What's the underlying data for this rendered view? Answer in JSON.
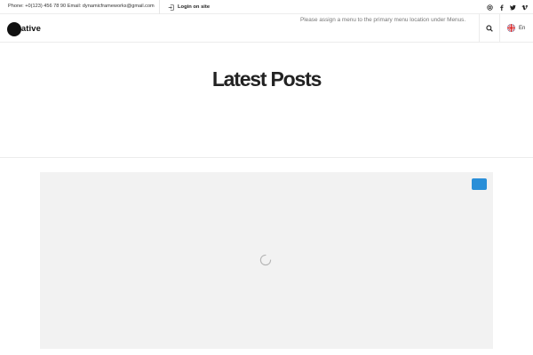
{
  "topbar": {
    "contact": "Phone: +0(123) 456 78 90 Email: dynamicframeworks@gmail.com",
    "login_label": "Login on site",
    "login_icon": "login-icon",
    "social_icons": [
      "instagram-icon",
      "facebook-icon",
      "twitter-icon",
      "vimeo-icon"
    ]
  },
  "header": {
    "logo_text": "native",
    "menu_note": "Please assign a menu to the primary menu location under Menus.",
    "search_icon": "search-icon",
    "language": {
      "label": "En",
      "flag_icon": "uk-flag-icon"
    }
  },
  "main": {
    "page_title": "Latest Posts",
    "loading_icon": "loading-spinner-icon"
  },
  "colors": {
    "accent": "#2a8fd8",
    "content_bg": "#f2f2f2",
    "text": "#222222",
    "muted": "#777777"
  }
}
